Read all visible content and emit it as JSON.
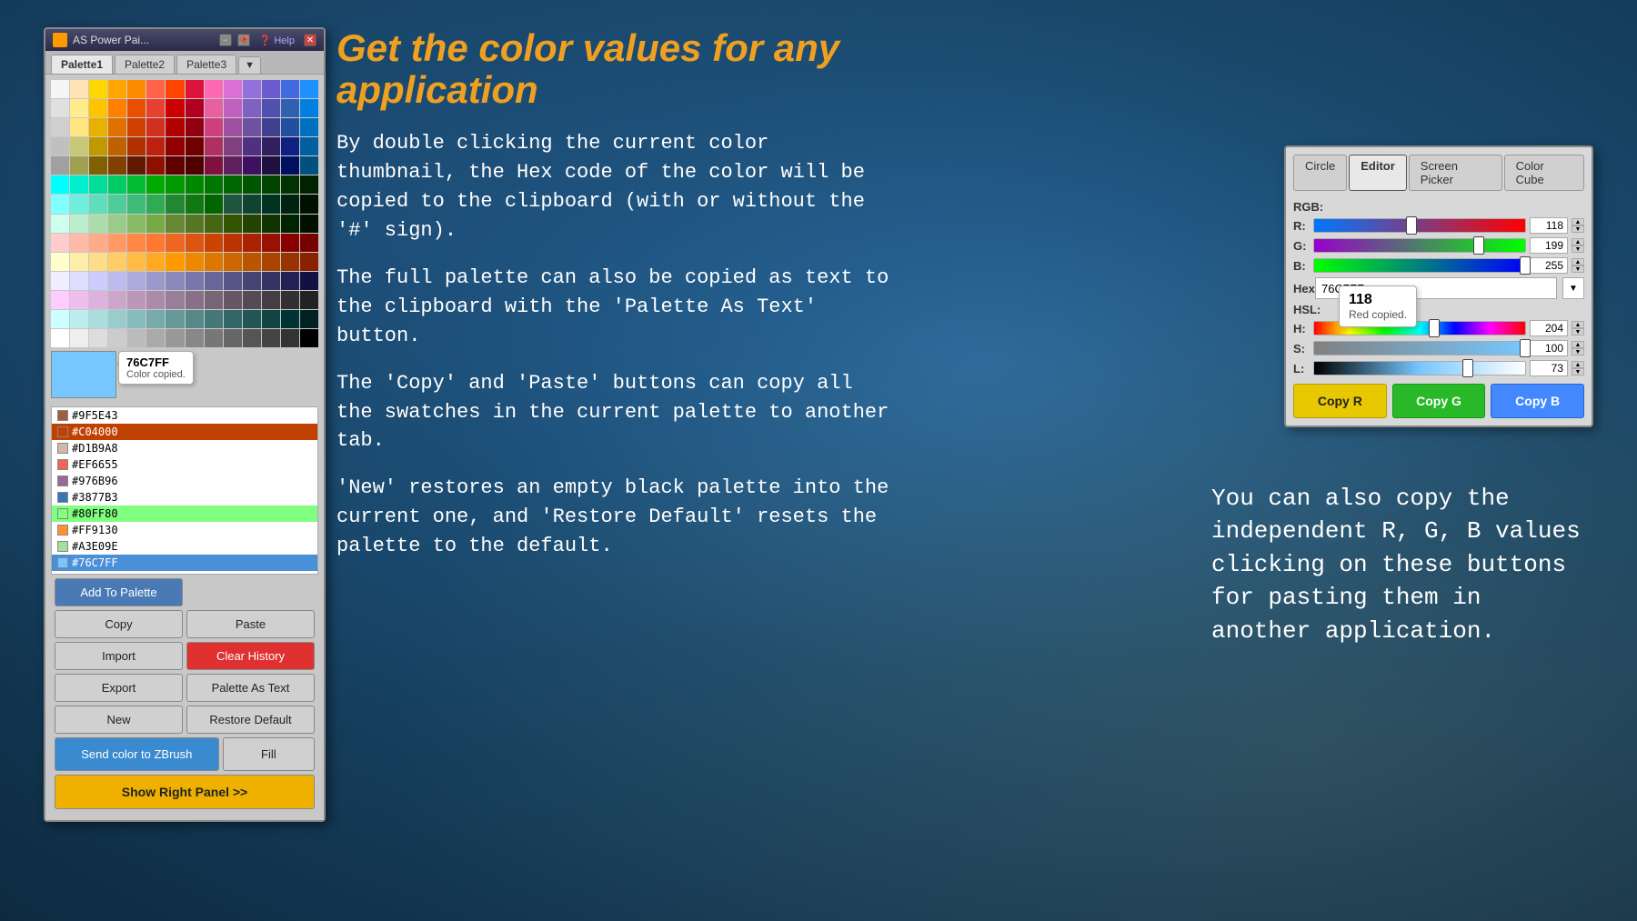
{
  "background": {
    "color_primary": "#1a4a6e",
    "color_secondary": "#0d2a40"
  },
  "heading": "Get the color values for any application",
  "paragraphs": [
    "By double clicking the current color thumbnail, the Hex code of the color will be copied to the clipboard (with or without the '#' sign).",
    "The full palette can also be copied as text to the clipboard with the 'Palette As Text' button.",
    "The 'Copy' and 'Paste' buttons can copy all the swatches in the current palette to another tab.",
    "'New' restores an empty black palette into the current one, and 'Restore Default' resets the palette to the default."
  ],
  "right_bottom_text": "You can also copy the independent R, G, B values clicking on these buttons for pasting them in another application.",
  "app_window": {
    "title": "AS Power Pai...",
    "tabs": [
      "Palette1",
      "Palette2",
      "Palette3"
    ],
    "active_tab": "Palette1",
    "color_preview": "#76c7ff",
    "tooltip_hex": "76C7FF",
    "tooltip_sub": "Color copied.",
    "history_items": [
      {
        "hex": "#9F5E43",
        "color": "#9F5E43"
      },
      {
        "hex": "#C04000",
        "color": "#C04000"
      },
      {
        "hex": "#D1B9A8",
        "color": "#D1B9A8"
      },
      {
        "hex": "#EF6655",
        "color": "#EF6655"
      },
      {
        "hex": "#976B96",
        "color": "#976B96"
      },
      {
        "hex": "#3877B3",
        "color": "#3877B3"
      },
      {
        "hex": "#80FF80",
        "color": "#80FF80"
      },
      {
        "hex": "#FF9130",
        "color": "#FF9130"
      },
      {
        "hex": "#A3E09E",
        "color": "#A3E09E"
      },
      {
        "hex": "#76C7FF",
        "color": "#76C7FF"
      }
    ],
    "buttons": {
      "add_to_palette": "Add To Palette",
      "copy": "Copy",
      "paste": "Paste",
      "import": "Import",
      "clear_history": "Clear History",
      "export": "Export",
      "palette_as_text": "Palette As Text",
      "new": "New",
      "restore_default": "Restore Default",
      "send_to_zbrush": "Send color to ZBrush",
      "fill": "Fill",
      "show_right_panel": "Show Right Panel >>"
    }
  },
  "color_editor": {
    "tabs": [
      "Circle",
      "Editor",
      "Screen Picker",
      "Color Cube"
    ],
    "active_tab": "Editor",
    "rgb_label": "RGB:",
    "r_value": "118",
    "g_value": "199",
    "b_value": "255",
    "hex_value": "76C7FF",
    "hsl_label": "HSL:",
    "h_value": "204",
    "s_value": "100",
    "l_value": "73",
    "r_thumb_pos": "46",
    "g_thumb_pos": "78",
    "b_thumb_pos": "100",
    "h_thumb_pos": "57",
    "s_thumb_pos": "100",
    "l_thumb_pos": "73",
    "value_tooltip": "118",
    "value_tooltip_sub": "Red copied.",
    "copy_r_label": "Copy R",
    "copy_g_label": "Copy G",
    "copy_b_label": "Copy B"
  },
  "colors": {
    "row1": [
      "#f5f5f5",
      "#ffe4b5",
      "#ffd700",
      "#ffa500",
      "#ff8c00",
      "#ff6347",
      "#ff4500",
      "#dc143c",
      "#ff69b4",
      "#da70d6",
      "#9370db",
      "#6a5acd",
      "#4169e1",
      "#1e90ff"
    ],
    "row2": [
      "#e0e0e0",
      "#ffec8b",
      "#ffc300",
      "#ff8000",
      "#e85000",
      "#e84030",
      "#cc0000",
      "#b00020",
      "#e860a0",
      "#c060c0",
      "#8060c0",
      "#5050b0",
      "#3060b0",
      "#0080e0"
    ],
    "row3": [
      "#d0d0d0",
      "#ffe680",
      "#e8b000",
      "#e07000",
      "#d04000",
      "#d03020",
      "#b00000",
      "#900010",
      "#d04080",
      "#a050a0",
      "#7050a0",
      "#404090",
      "#2050a0",
      "#0070c0"
    ],
    "row4": [
      "#c0c0c0",
      "#c8c878",
      "#c09800",
      "#c06000",
      "#b03000",
      "#c02010",
      "#900000",
      "#700000",
      "#b03060",
      "#804080",
      "#503080",
      "#302060",
      "#102080",
      "#0060a0"
    ],
    "row5": [
      "#a0a0a0",
      "#a0a050",
      "#806000",
      "#804000",
      "#601800",
      "#901000",
      "#600000",
      "#500000",
      "#801040",
      "#602060",
      "#401060",
      "#201040",
      "#001060",
      "#005080"
    ],
    "row6": [
      "#00ffff",
      "#00eecc",
      "#00dd99",
      "#00cc66",
      "#00bb33",
      "#00aa00",
      "#009900",
      "#008800",
      "#007700",
      "#006600",
      "#005500",
      "#004400",
      "#003300",
      "#002200"
    ],
    "row7": [
      "#80ffff",
      "#70eedd",
      "#60ddbb",
      "#50cc99",
      "#40bb77",
      "#30aa55",
      "#208833",
      "#107711",
      "#006600",
      "#205540",
      "#104430",
      "#003320",
      "#002210",
      "#001100"
    ],
    "row8": [
      "#ccffee",
      "#bbeecc",
      "#aaddaa",
      "#99cc88",
      "#88bb66",
      "#77aa44",
      "#668833",
      "#557722",
      "#446611",
      "#335500",
      "#224400",
      "#113300",
      "#002200",
      "#001100"
    ],
    "row9": [
      "#ffcccc",
      "#ffbbaa",
      "#ffaa88",
      "#ff9966",
      "#ff8844",
      "#ff7733",
      "#ee6622",
      "#dd5511",
      "#cc4400",
      "#bb3300",
      "#aa2200",
      "#991100",
      "#880000",
      "#770000"
    ],
    "row10": [
      "#ffffcc",
      "#ffeeaa",
      "#ffdd88",
      "#ffcc66",
      "#ffbb44",
      "#ffaa22",
      "#ff9900",
      "#ee8800",
      "#dd7700",
      "#cc6600",
      "#bb5500",
      "#aa4400",
      "#993300",
      "#882200"
    ],
    "row11": [
      "#eeeeff",
      "#ddddff",
      "#ccccff",
      "#bbbbee",
      "#aaaadd",
      "#9999cc",
      "#8888bb",
      "#7777aa",
      "#666699",
      "#555588",
      "#444477",
      "#333366",
      "#222255",
      "#111144"
    ],
    "row12": [
      "#ffccff",
      "#eebfee",
      "#ddb2dd",
      "#cca5cc",
      "#bb98bb",
      "#aa8baa",
      "#997e99",
      "#887188",
      "#776477",
      "#665766",
      "#554a55",
      "#443d44",
      "#333033",
      "#222222"
    ],
    "row13": [
      "#ccffff",
      "#bbeeee",
      "#aadddd",
      "#99cccc",
      "#88bbbb",
      "#77aaaa",
      "#669999",
      "#558888",
      "#447777",
      "#336666",
      "#225555",
      "#114444",
      "#003333",
      "#002222"
    ],
    "row14": [
      "#ffffff",
      "#eeeeee",
      "#dddddd",
      "#cccccc",
      "#bbbbbb",
      "#aaaaaa",
      "#999999",
      "#888888",
      "#777777",
      "#666666",
      "#555555",
      "#444444",
      "#333333",
      "#000000"
    ]
  }
}
